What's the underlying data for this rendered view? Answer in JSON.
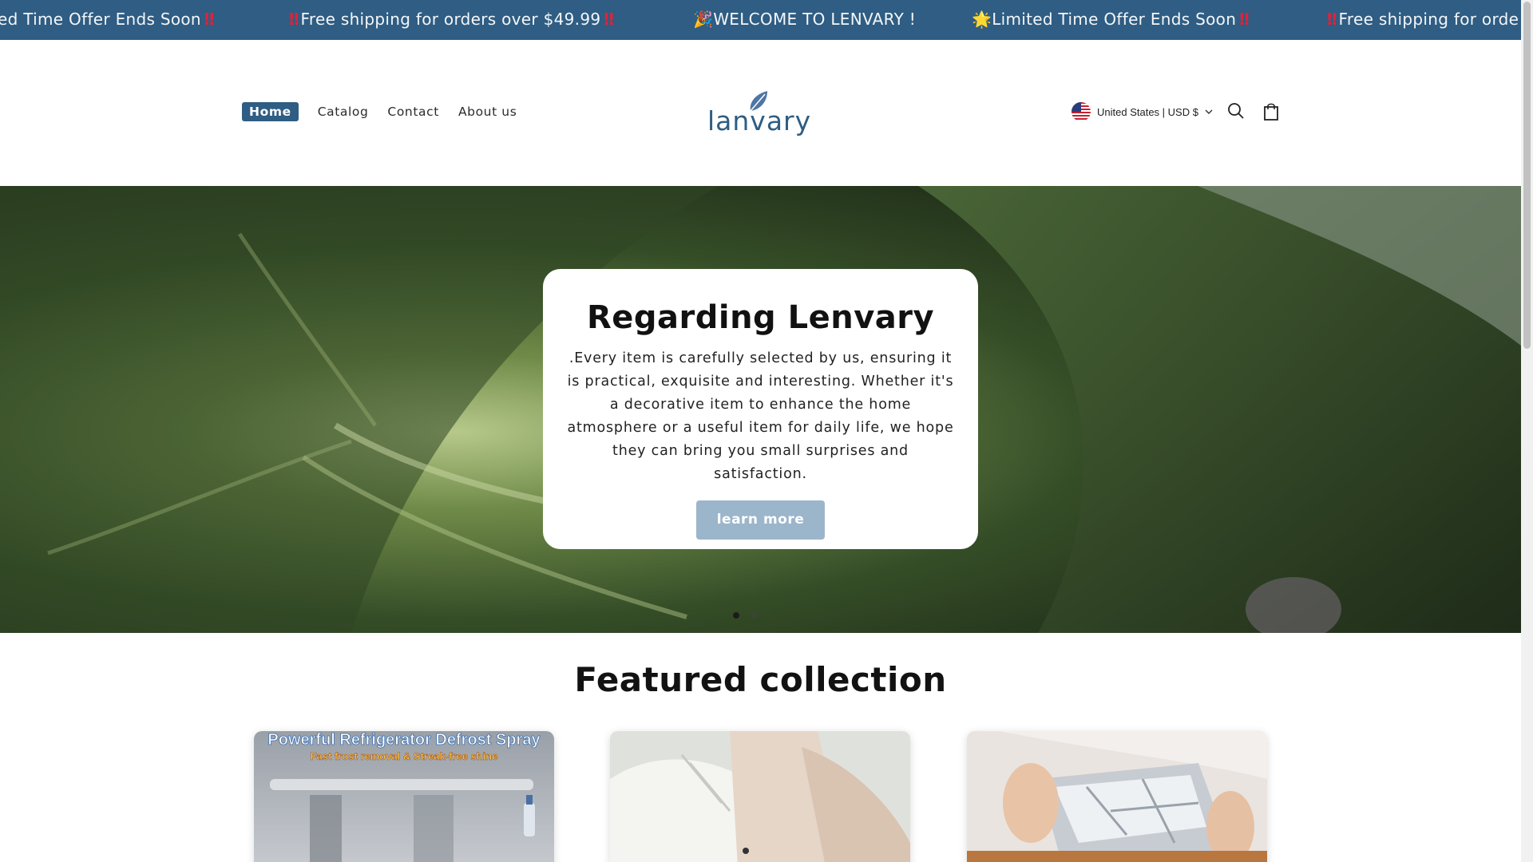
{
  "announcement": {
    "items": [
      {
        "prefix": "",
        "text": "ed Time Offer Ends Soon",
        "suffix": "‼"
      },
      {
        "prefix": "‼",
        "text": "Free shipping for orders over $49.99",
        "suffix": "‼"
      },
      {
        "prefix": "🎉",
        "text": "WELCOME TO LENVARY !",
        "suffix": ""
      },
      {
        "prefix": "🌟",
        "text": "Limited Time Offer Ends Soon",
        "suffix": "‼"
      },
      {
        "prefix": "‼",
        "text": "Free shipping for orde",
        "suffix": ""
      }
    ]
  },
  "header": {
    "nav": [
      {
        "label": "Home",
        "active": true
      },
      {
        "label": "Catalog",
        "active": false
      },
      {
        "label": "Contact",
        "active": false
      },
      {
        "label": "About us",
        "active": false
      }
    ],
    "logo_text": "lanvary",
    "locale_label": "United States | USD $"
  },
  "hero": {
    "title": "Regarding Lenvary",
    "body": ".Every item is carefully selected by us, ensuring it is practical, exquisite and interesting. Whether it's a decorative item to enhance the home atmosphere or a useful item for daily life, we hope they can bring you small surprises and satisfaction.",
    "button_label": "learn more",
    "slide_count": 2,
    "active_slide": 0
  },
  "featured": {
    "title": "Featured collection",
    "products": [
      {
        "banner_line1": "Powerful Refrigerator Defrost Spray",
        "banner_line2": "Fast frost removal & Streak-free shine"
      },
      {
        "banner_line1": "",
        "banner_line2": ""
      },
      {
        "banner_line1": "",
        "banner_line2": ""
      }
    ]
  },
  "colors": {
    "brand": "#2f5d83",
    "button": "#9bb5cb",
    "alert": "#e0223a"
  }
}
